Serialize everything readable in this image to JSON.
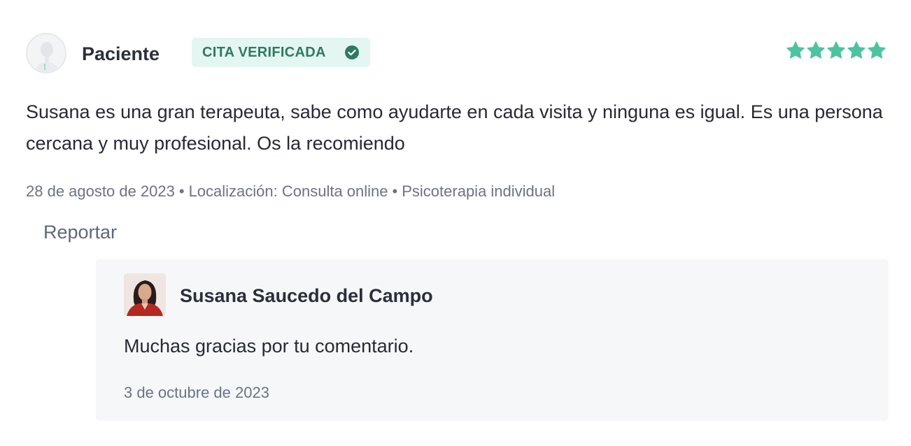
{
  "review": {
    "author": "Paciente",
    "author_avatar_icon": "anonymous-patient-avatar-icon",
    "verified_label": "CITA VERIFICADA",
    "verified_icon": "check-circle-icon",
    "rating": 5,
    "rating_max": 5,
    "star_color": "#4cc3a1",
    "comment": "Susana es una gran terapeuta, sabe como ayudarte en cada visita y ninguna es igual. Es una persona cercana y muy profesional. Os la recomiendo",
    "date": "28 de agosto de 2023",
    "location": "Localización: Consulta online",
    "service": "Psicoterapia individual",
    "meta_separator": "•",
    "report_label": "Reportar"
  },
  "reply": {
    "author": "Susana Saucedo del Campo",
    "text": "Muchas gracias por tu comentario.",
    "date": "3 de octubre de 2023"
  },
  "colors": {
    "badge_background": "#e3f6f1",
    "badge_text": "#2f7a5e",
    "reply_background": "#f6f7f9",
    "muted_text": "#6b7385"
  }
}
